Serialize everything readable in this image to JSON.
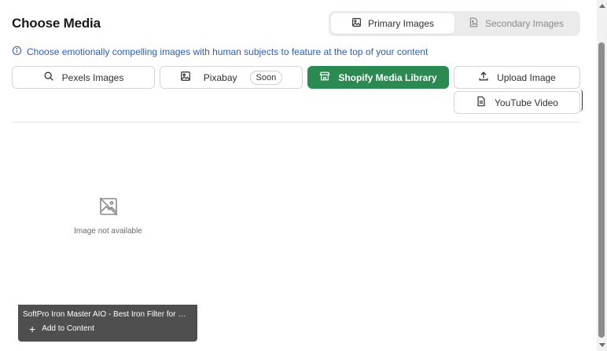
{
  "header": {
    "title": "Choose Media"
  },
  "tabs": [
    {
      "label": "Primary Images",
      "icon": "image-icon",
      "active": true
    },
    {
      "label": "Secondary Images",
      "icon": "image-file-icon",
      "active": false
    }
  ],
  "info": {
    "text": "Choose emotionally compelling images with human subjects to feature at the top of your content",
    "color": "#2c5cc5"
  },
  "sources": {
    "pexels": {
      "label": "Pexels Images",
      "icon": "search-icon"
    },
    "pixabay": {
      "label": "Pixabay",
      "icon": "image-icon",
      "badge": "Soon"
    },
    "shopify": {
      "label": "Shopify Media Library",
      "icon": "store-icon",
      "color": "#2a8a52"
    },
    "upload": {
      "label": "Upload Image",
      "icon": "upload-icon"
    },
    "youtube": {
      "label": "YouTube Video",
      "icon": "document-icon"
    }
  },
  "media_card": {
    "placeholder_text": "Image not available",
    "title": "SoftPro Iron Master AIO - Best Iron Filter for Well...",
    "add_label": "Add to Content"
  }
}
